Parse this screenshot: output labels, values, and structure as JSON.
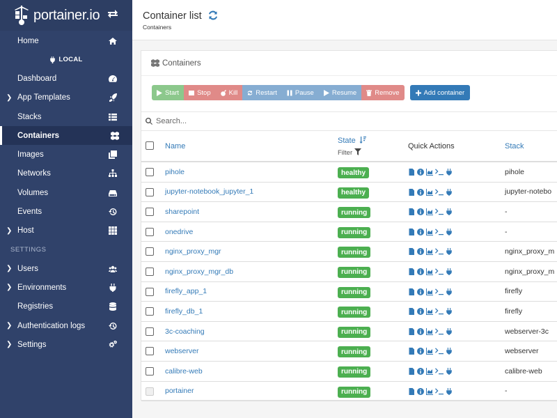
{
  "app": {
    "logo_text": "portainer.io"
  },
  "sidebar": {
    "items_top": [
      {
        "label": "Home",
        "icon": "home-icon"
      }
    ],
    "endpoint_label": "LOCAL",
    "items_endpoint": [
      {
        "label": "Dashboard",
        "icon": "dashboard-icon",
        "caret": false
      },
      {
        "label": "App Templates",
        "icon": "rocket-icon",
        "caret": true
      },
      {
        "label": "Stacks",
        "icon": "list-icon",
        "caret": false
      },
      {
        "label": "Containers",
        "icon": "cubes-icon",
        "caret": false,
        "active": true
      },
      {
        "label": "Images",
        "icon": "clone-icon",
        "caret": false
      },
      {
        "label": "Networks",
        "icon": "sitemap-icon",
        "caret": false
      },
      {
        "label": "Volumes",
        "icon": "hdd-icon",
        "caret": false
      },
      {
        "label": "Events",
        "icon": "history-icon",
        "caret": false
      },
      {
        "label": "Host",
        "icon": "th-icon",
        "caret": true
      }
    ],
    "settings_heading": "SETTINGS",
    "items_settings": [
      {
        "label": "Users",
        "icon": "users-icon",
        "caret": true
      },
      {
        "label": "Environments",
        "icon": "plug-icon",
        "caret": true
      },
      {
        "label": "Registries",
        "icon": "database-icon",
        "caret": false
      },
      {
        "label": "Authentication logs",
        "icon": "history-icon",
        "caret": true
      },
      {
        "label": "Settings",
        "icon": "cogs-icon",
        "caret": true
      }
    ]
  },
  "header": {
    "title": "Container list",
    "breadcrumb": "Containers"
  },
  "panel": {
    "title": "Containers"
  },
  "toolbar": {
    "start": "Start",
    "stop": "Stop",
    "kill": "Kill",
    "restart": "Restart",
    "pause": "Pause",
    "resume": "Resume",
    "remove": "Remove",
    "add": "Add container"
  },
  "search": {
    "placeholder": "Search..."
  },
  "table": {
    "columns": {
      "name": "Name",
      "state": "State",
      "filter": "Filter",
      "quick_actions": "Quick Actions",
      "stack": "Stack"
    },
    "rows": [
      {
        "name": "pihole",
        "state": "healthy",
        "stack": "pihole"
      },
      {
        "name": "jupyter-notebook_jupyter_1",
        "state": "healthy",
        "stack": "jupyter-notebo"
      },
      {
        "name": "sharepoint",
        "state": "running",
        "stack": "-"
      },
      {
        "name": "onedrive",
        "state": "running",
        "stack": "-"
      },
      {
        "name": "nginx_proxy_mgr",
        "state": "running",
        "stack": "nginx_proxy_m"
      },
      {
        "name": "nginx_proxy_mgr_db",
        "state": "running",
        "stack": "nginx_proxy_m"
      },
      {
        "name": "firefly_app_1",
        "state": "running",
        "stack": "firefly"
      },
      {
        "name": "firefly_db_1",
        "state": "running",
        "stack": "firefly"
      },
      {
        "name": "3c-coaching",
        "state": "running",
        "stack": "webserver-3c"
      },
      {
        "name": "webserver",
        "state": "running",
        "stack": "webserver"
      },
      {
        "name": "calibre-web",
        "state": "running",
        "stack": "calibre-web"
      },
      {
        "name": "portainer",
        "state": "running",
        "stack": "-"
      }
    ]
  },
  "colors": {
    "sidebar": "#30426a",
    "primary": "#337ab7",
    "success": "#4caf50",
    "danger": "#e08a88"
  }
}
